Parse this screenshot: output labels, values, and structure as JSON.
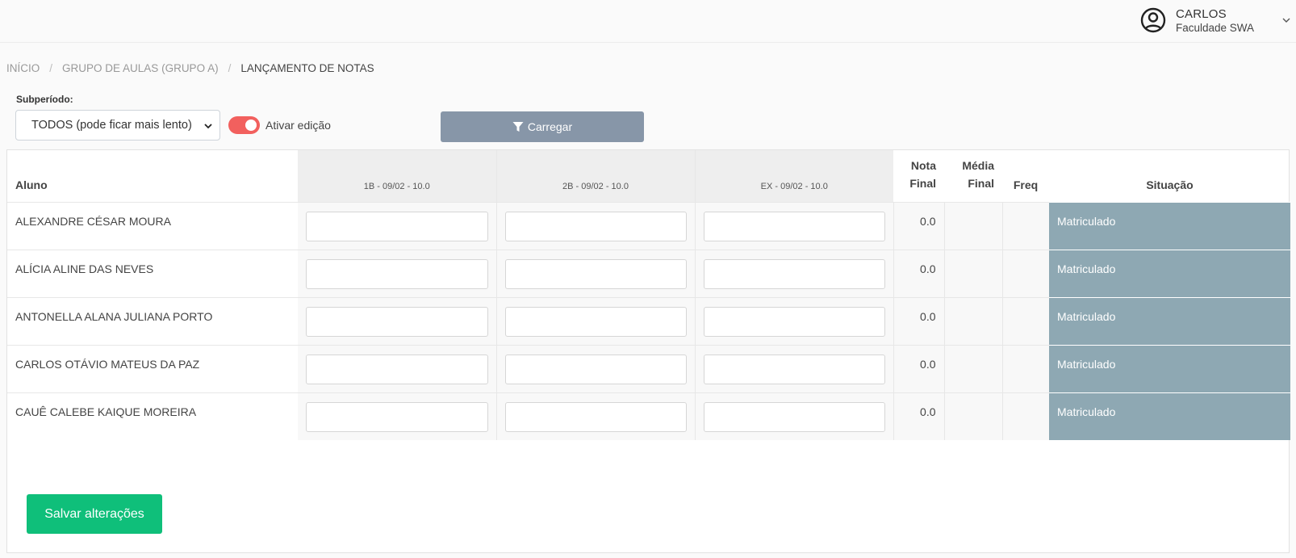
{
  "user": {
    "name": "CARLOS",
    "organization": "Faculdade SWA",
    "icon": "user-circle-icon"
  },
  "breadcrumb": [
    {
      "label": "INÍCIO"
    },
    {
      "label": "GRUPO DE AULAS (GRUPO A)"
    },
    {
      "label": "LANÇAMENTO DE NOTAS"
    }
  ],
  "filters": {
    "subperiod_label": "Subperíodo:",
    "subperiod_value": "TODOS (pode ficar mais lento)",
    "edit_toggle_label": "Ativar edição",
    "edit_toggle_on": true,
    "load_button_label": "Carregar",
    "load_button_icon": "filter-icon"
  },
  "table": {
    "headers": {
      "student": "Aluno",
      "col1": "1B - 09/02 - 10.0",
      "col2": "2B - 09/02 - 10.0",
      "col3": "EX - 09/02 - 10.0",
      "final_grade_line1": "Nota",
      "final_grade_line2": "Final",
      "final_avg_line1": "Média",
      "final_avg_line2": "Final",
      "freq": "Freq",
      "status": "Situação"
    },
    "rows": [
      {
        "name": "ALEXANDRE CÉSAR MOURA",
        "nota_final": "0.0",
        "media_final": "",
        "freq": "",
        "situacao": "Matriculado"
      },
      {
        "name": "ALÍCIA ALINE DAS NEVES",
        "nota_final": "0.0",
        "media_final": "",
        "freq": "",
        "situacao": "Matriculado"
      },
      {
        "name": "ANTONELLA ALANA JULIANA PORTO",
        "nota_final": "0.0",
        "media_final": "",
        "freq": "",
        "situacao": "Matriculado"
      },
      {
        "name": "CARLOS OTÁVIO MATEUS DA PAZ",
        "nota_final": "0.0",
        "media_final": "",
        "freq": "",
        "situacao": "Matriculado"
      },
      {
        "name": "CAUÊ CALEBE KAIQUE MOREIRA",
        "nota_final": "0.0",
        "media_final": "",
        "freq": "",
        "situacao": "Matriculado"
      }
    ]
  },
  "colors": {
    "accent_save": "#0fbf7a",
    "toggle_on": "#f2605e",
    "load_button": "#8796a8",
    "status_cell": "#8ea8b3"
  },
  "actions": {
    "save_label": "Salvar alterações"
  }
}
